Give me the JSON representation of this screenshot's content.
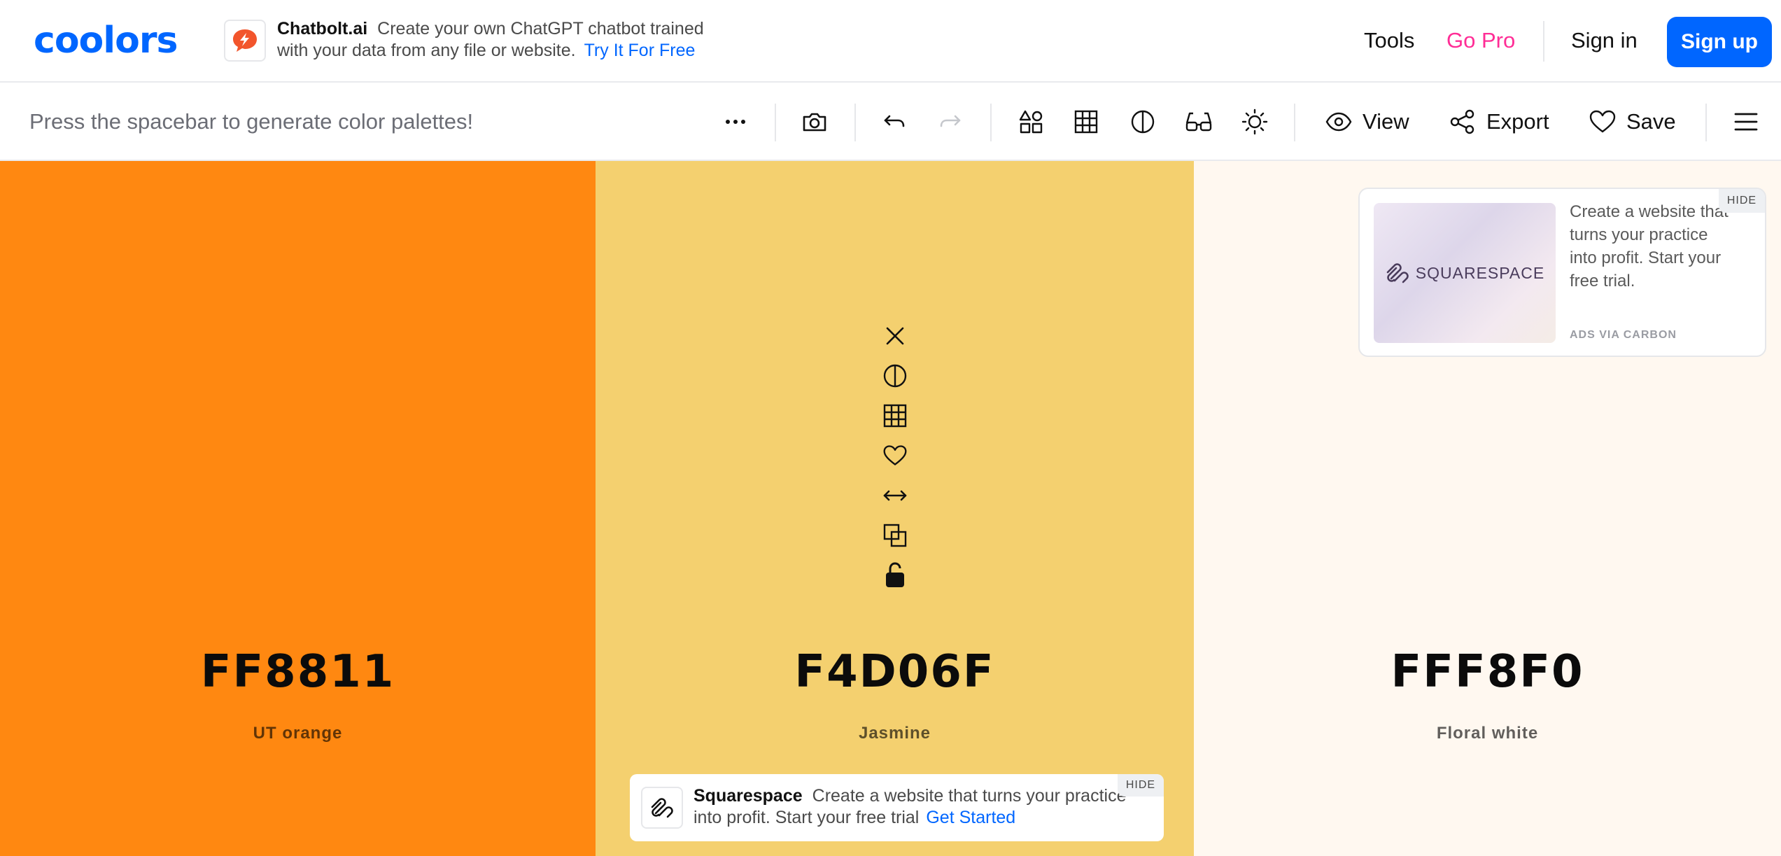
{
  "app": {
    "logo": "coolors"
  },
  "top_ad": {
    "brand": "Chatbolt.ai",
    "text_line1": "Create your own ChatGPT chatbot trained",
    "text_line2": "with your data from any file or website.",
    "cta": "Try It For Free",
    "icon": "chatbolt-logo-icon"
  },
  "nav": {
    "tools": "Tools",
    "go_pro": "Go Pro",
    "sign_in": "Sign in",
    "sign_up": "Sign up"
  },
  "toolbar": {
    "hint": "Press the spacebar to generate color palettes!",
    "view": "View",
    "export": "Export",
    "save": "Save",
    "icons": [
      "more-icon",
      "camera-icon",
      "undo-icon",
      "redo-icon",
      "shapes-icon",
      "grid-icon",
      "contrast-icon",
      "glasses-icon",
      "brightness-icon",
      "eye-icon",
      "share-icon",
      "heart-icon",
      "menu-icon"
    ]
  },
  "palette": {
    "colors": [
      {
        "hex": "FF8811",
        "name": "UT orange",
        "swatch": "#FF8811"
      },
      {
        "hex": "F4D06F",
        "name": "Jasmine",
        "swatch": "#F4D06F"
      },
      {
        "hex": "FFF8F0",
        "name": "Floral white",
        "swatch": "#FFF8F0"
      }
    ],
    "column_tools": [
      "close-icon",
      "contrast-icon",
      "grid-icon",
      "heart-icon",
      "drag-horizontal-icon",
      "copy-icon",
      "lock-open-icon"
    ]
  },
  "carbon_ad": {
    "image_text": "SQUARESPACE",
    "copy": "Create a website that turns your practice into profit. Start your free trial.",
    "via": "ADS VIA CARBON",
    "hide": "HIDE"
  },
  "bottom_ad": {
    "brand": "Squarespace",
    "text": "Create a website that turns your practice into profit. Start your free trial",
    "cta": "Get Started",
    "hide": "HIDE"
  },
  "colors": {
    "accent": "#0066ff",
    "go_pro": "#ff2d96"
  }
}
